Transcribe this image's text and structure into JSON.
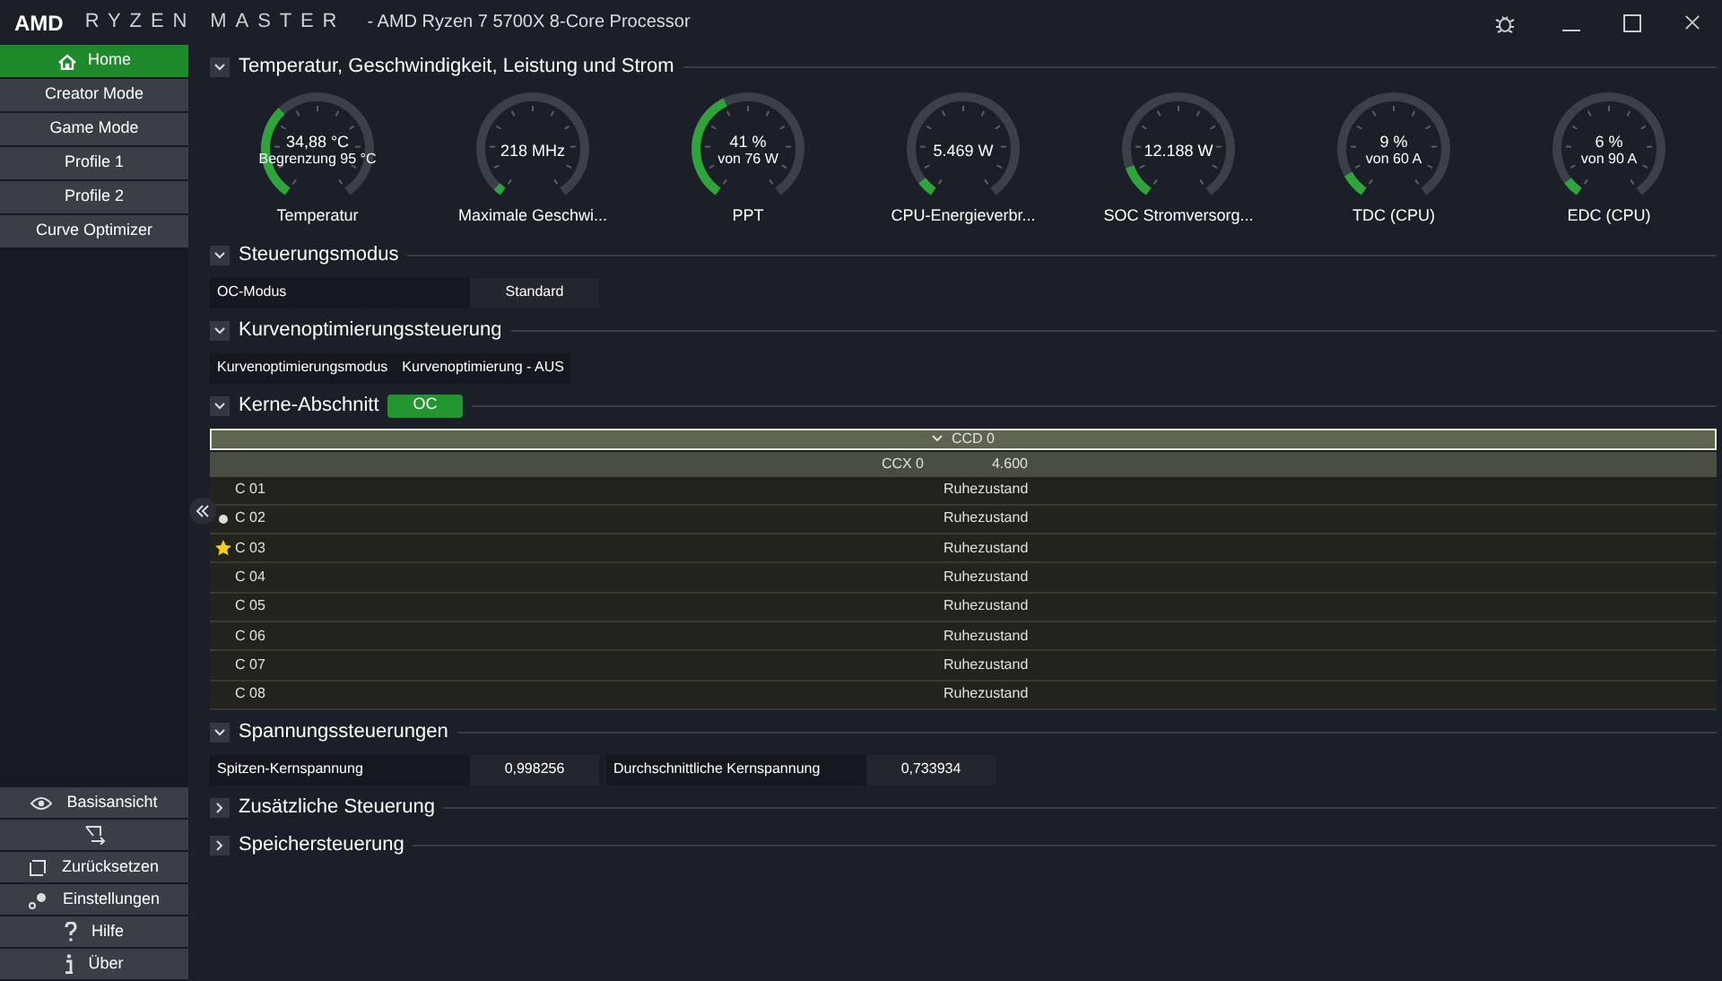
{
  "window": {
    "brand": "AMD",
    "app_name": "RYZEN MASTER",
    "title": "- AMD Ryzen 7 5700X 8-Core Processor"
  },
  "sidebar": {
    "items": [
      {
        "label": "Home",
        "selected": true
      },
      {
        "label": "Creator Mode",
        "selected": false
      },
      {
        "label": "Game Mode",
        "selected": false
      },
      {
        "label": "Profile 1",
        "selected": false
      },
      {
        "label": "Profile 2",
        "selected": false
      },
      {
        "label": "Curve Optimizer",
        "selected": false
      }
    ],
    "bottom_items": [
      {
        "kind": "eye",
        "label": "Basisansicht"
      },
      {
        "kind": "switch"
      },
      {
        "kind": "reset",
        "label": "Zurücksetzen"
      },
      {
        "kind": "gear",
        "label": "Einstellungen"
      },
      {
        "kind": "help",
        "label": "Hilfe"
      },
      {
        "kind": "info",
        "label": "Über"
      }
    ]
  },
  "sections": [
    {
      "kind": "gauges",
      "title": "Temperatur, Geschwindigkeit, Leistung und Strom",
      "expanded": true,
      "gauges": [
        {
          "value": "34,88 °C",
          "sub": "Begrenzung 95 °C",
          "label": "Temperatur"
        },
        {
          "value": "218  MHz",
          "label": "Maximale Geschwi..."
        },
        {
          "value": "41 %",
          "sub": "von 76 W",
          "label": "PPT"
        },
        {
          "value": "5.469 W",
          "label": "CPU-Energieverbr..."
        },
        {
          "value": "12.188 W",
          "label": "SOC Stromversorg..."
        },
        {
          "value": "9 %",
          "sub": "von 60 A",
          "label": "TDC (CPU)"
        },
        {
          "value": "6 %",
          "sub": "von 90 A",
          "label": "EDC (CPU)"
        }
      ]
    },
    {
      "kind": "fields",
      "title": "Steuerungsmodus",
      "expanded": true,
      "fields": [
        {
          "label": "OC-Modus",
          "value": "Standard"
        }
      ]
    },
    {
      "kind": "fields",
      "title": "Kurvenoptimierungssteuerung",
      "expanded": true,
      "fields": [
        {
          "label": "Kurvenoptimierungsmodus",
          "value": "Kurvenoptimierung - AUS"
        }
      ]
    },
    {
      "kind": "cores",
      "title": "Kerne-Abschnitt",
      "badge": "OC",
      "expanded": true,
      "ccd": "CCD 0",
      "ccx": "CCX 0",
      "ccx_value": "4.600",
      "cores": [
        {
          "name": "C 01",
          "kind": "plain",
          "state": "Ruhezustand"
        },
        {
          "name": "C 02",
          "kind": "dot",
          "state": "Ruhezustand"
        },
        {
          "name": "C 03",
          "kind": "star",
          "state": "Ruhezustand"
        },
        {
          "name": "C 04",
          "kind": "plain",
          "state": "Ruhezustand"
        },
        {
          "name": "C 05",
          "kind": "plain",
          "state": "Ruhezustand"
        },
        {
          "name": "C 06",
          "kind": "plain",
          "state": "Ruhezustand"
        },
        {
          "name": "C 07",
          "kind": "plain",
          "state": "Ruhezustand"
        },
        {
          "name": "C 08",
          "kind": "plain",
          "state": "Ruhezustand"
        }
      ]
    },
    {
      "kind": "fields",
      "title": "Spannungssteuerungen",
      "expanded": true,
      "fields": [
        {
          "label": "Spitzen-Kernspannung",
          "value": "0,998256"
        },
        {
          "label": "Durchschnittliche Kernspannung",
          "value": "0,733934"
        }
      ]
    },
    {
      "title": "Zusätzliche Steuerung",
      "expanded": false
    },
    {
      "title": "Speichersteuerung",
      "expanded": false
    }
  ]
}
